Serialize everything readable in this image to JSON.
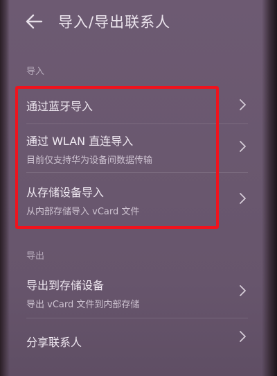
{
  "header": {
    "title": "导入/导出联系人"
  },
  "import_section": {
    "label": "导入",
    "items": [
      {
        "title": "通过蓝牙导入"
      },
      {
        "title": "通过 WLAN 直连导入",
        "subtitle": "目前仅支持华为设备间数据传输"
      },
      {
        "title": "从存储设备导入",
        "subtitle": "从内部存储导入 vCard 文件"
      }
    ]
  },
  "export_section": {
    "label": "导出",
    "items": [
      {
        "title": "导出到存储设备",
        "subtitle": "导出 vCard 文件到内部存储"
      },
      {
        "title": "分享联系人"
      }
    ]
  },
  "icons": {
    "back": "arrow-left-icon",
    "chevron": "chevron-right-icon"
  },
  "colors": {
    "background": "#6a586f",
    "highlight": "#f0131d"
  }
}
